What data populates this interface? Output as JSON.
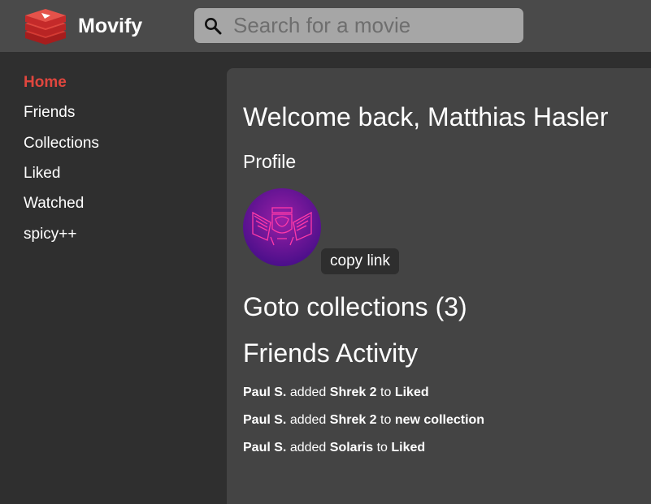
{
  "app": {
    "name": "Movify",
    "logo_icon": "stacked-bricks-logo",
    "accent_color": "#e0463e"
  },
  "search": {
    "placeholder": "Search for a movie",
    "value": ""
  },
  "sidebar": {
    "items": [
      {
        "label": "Home",
        "active": true
      },
      {
        "label": "Friends",
        "active": false
      },
      {
        "label": "Collections",
        "active": false
      },
      {
        "label": "Liked",
        "active": false
      },
      {
        "label": "Watched",
        "active": false
      },
      {
        "label": "spicy++",
        "active": false
      }
    ]
  },
  "main": {
    "welcome": "Welcome back, Matthias Hasler",
    "profile_heading": "Profile",
    "copy_link_label": "copy link",
    "goto_collections": "Goto collections (3)",
    "activity_heading": "Friends Activity",
    "activity": [
      {
        "user": "Paul S.",
        "verb": "added",
        "item": "Shrek 2",
        "prep": "to",
        "target": "Liked"
      },
      {
        "user": "Paul S.",
        "verb": "added",
        "item": "Shrek 2",
        "prep": "to",
        "target": "new collection"
      },
      {
        "user": "Paul S.",
        "verb": "added",
        "item": "Solaris",
        "prep": "to",
        "target": "Liked"
      }
    ]
  }
}
